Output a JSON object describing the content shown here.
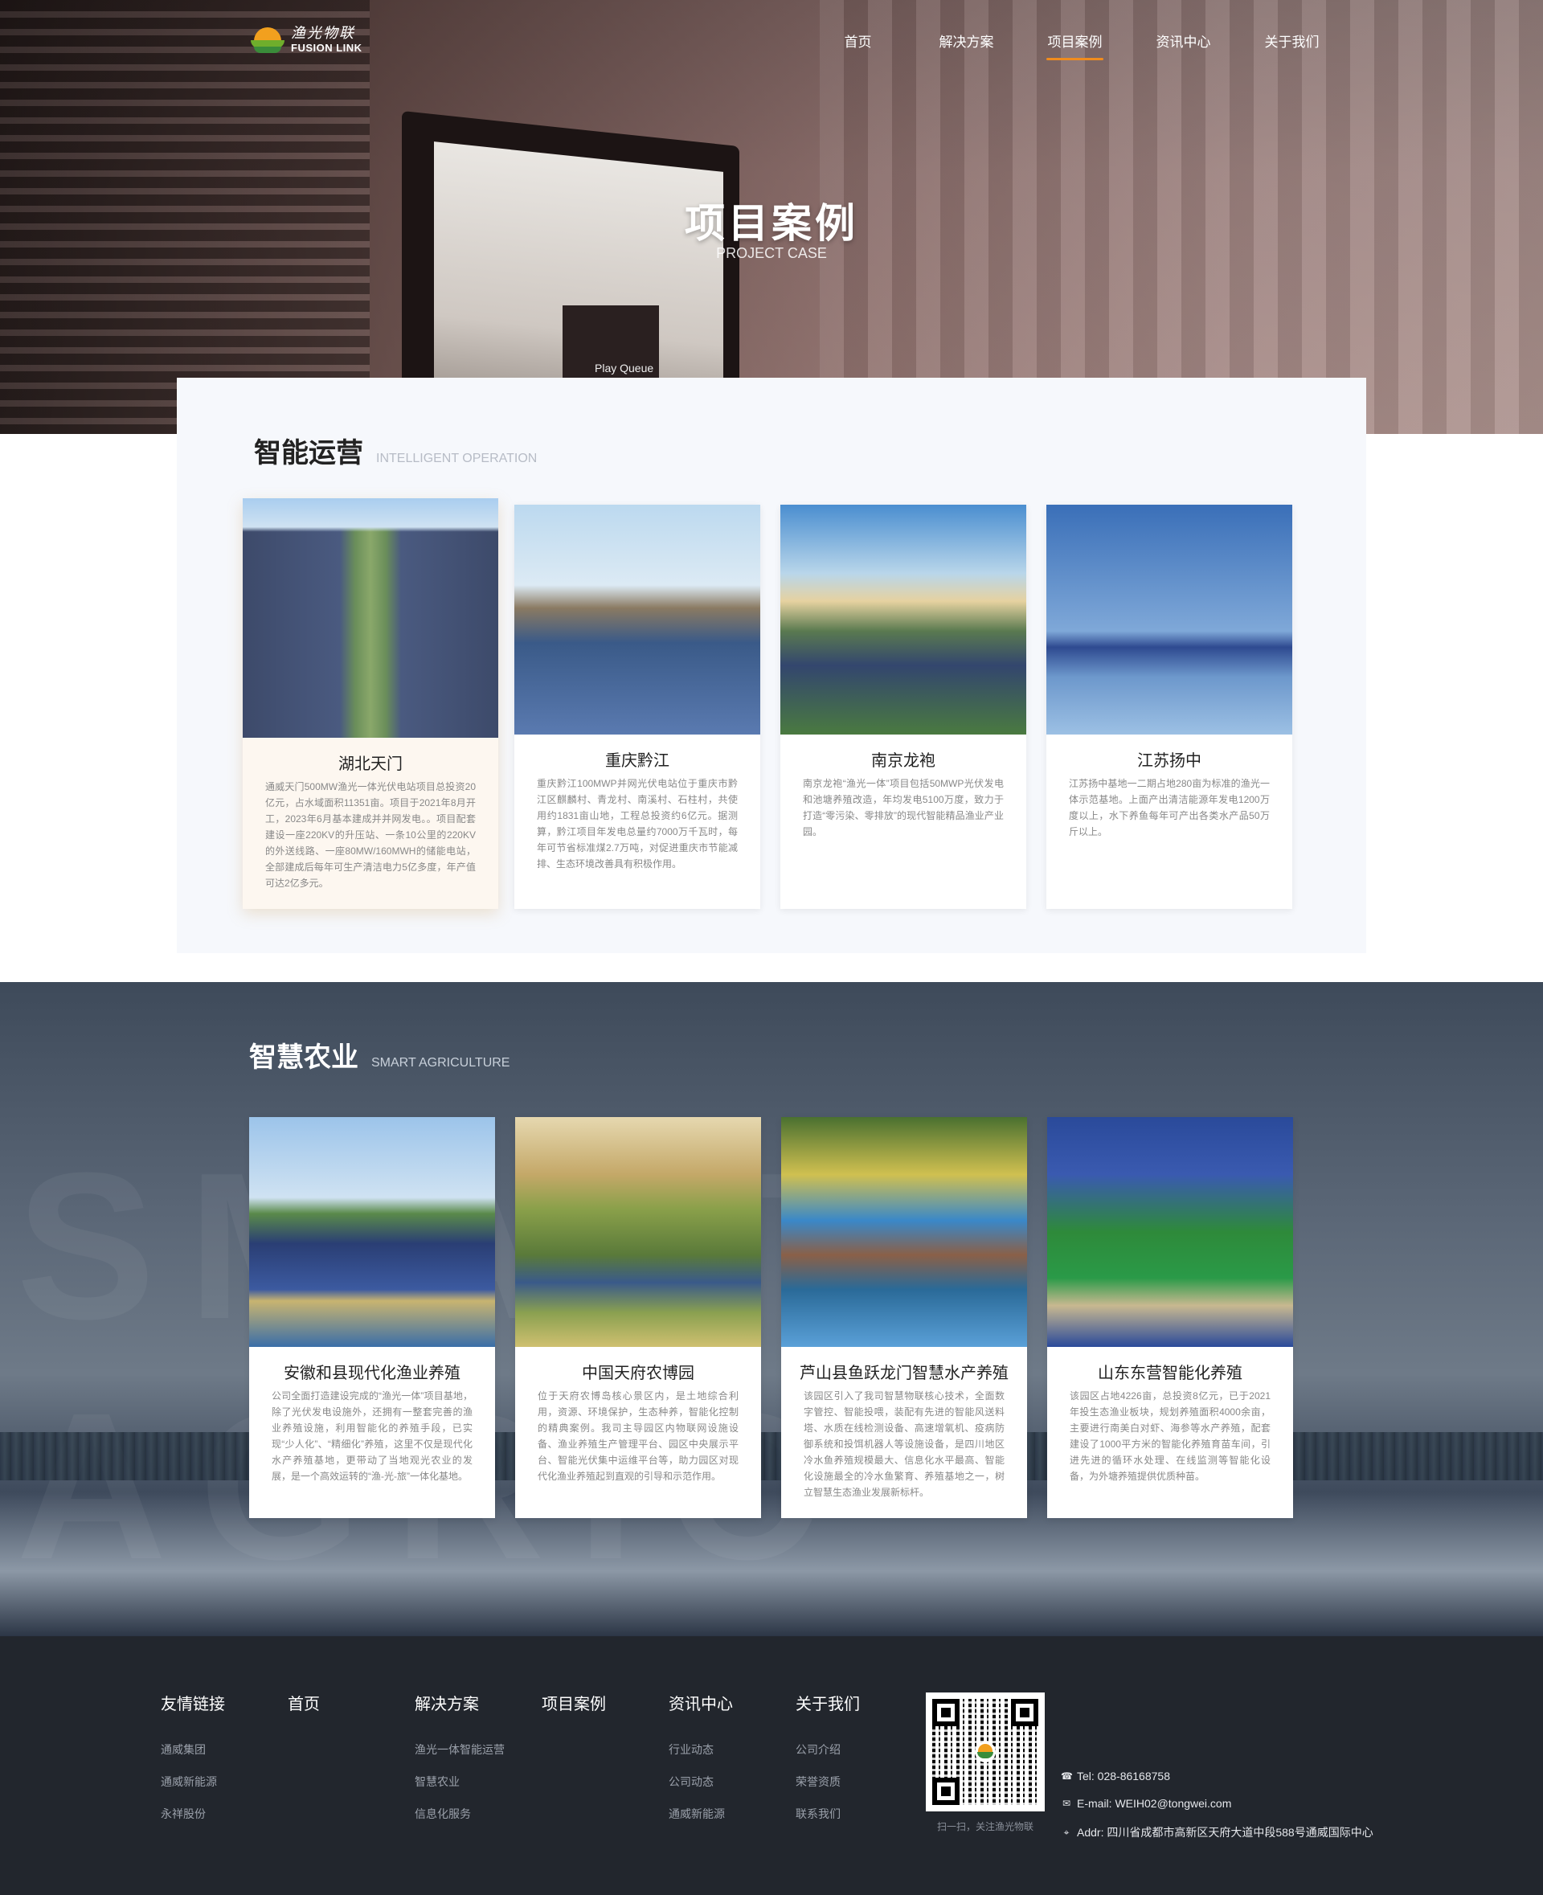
{
  "logo": {
    "cn": "渔光物联",
    "en": "FUSION LINK"
  },
  "nav": [
    {
      "label": "首页",
      "active": false
    },
    {
      "label": "解决方案",
      "active": false
    },
    {
      "label": "项目案例",
      "active": true
    },
    {
      "label": "资讯中心",
      "active": false
    },
    {
      "label": "关于我们",
      "active": false
    }
  ],
  "hero": {
    "title": "项目案例",
    "subtitle": "PROJECT CASE",
    "screen_text": "Play Queue"
  },
  "section1": {
    "title": "智能运营",
    "subtitle": "INTELLIGENT OPERATION",
    "cards": [
      {
        "name": "湖北天门",
        "desc": "通威天门500MW渔光一体光伏电站项目总投资20亿元，占水域面积11351亩。项目于2021年8月开工，2023年6月基本建成并并网发电。。项目配套建设一座220KV的升压站、一条10公里的220KV的外送线路、一座80MW/160MWH的储能电站，全部建成后每年可生产清洁电力5亿多度，年产值可达2亿多元。"
      },
      {
        "name": "重庆黔江",
        "desc": "重庆黔江100MWP并网光伏电站位于重庆市黔江区麒麟村、青龙村、南溪村、石柱村，共使用约1831亩山地，工程总投资约6亿元。据测算，黔江项目年发电总量约7000万千瓦时，每年可节省标准煤2.7万吨，对促进重庆市节能减排、生态环境改善具有积极作用。"
      },
      {
        "name": "南京龙袍",
        "desc": "南京龙袍“渔光一体”项目包括50MWP光伏发电和池塘养殖改造，年均发电5100万度，致力于打造“零污染、零排放”的现代智能精品渔业产业园。"
      },
      {
        "name": "江苏扬中",
        "desc": "江苏扬中基地一二期占地280亩为标准的渔光一体示范基地。上面产出清洁能源年发电1200万度以上，水下养鱼每年可产出各类水产品50万斤以上。"
      }
    ]
  },
  "section2": {
    "title": "智慧农业",
    "subtitle": "SMART AGRICULTURE",
    "bg_text": "SMART AGRIC",
    "cards": [
      {
        "name": "安徽和县现代化渔业养殖",
        "desc": "公司全面打造建设完成的“渔光一体”项目基地，除了光伏发电设施外，还拥有一整套完善的渔业养殖设施，利用智能化的养殖手段，已实现“少人化”、“精细化”养殖，这里不仅是现代化水产养殖基地，更带动了当地观光农业的发展，是一个高效运转的“渔-光-旅”一体化基地。"
      },
      {
        "name": "中国天府农博园",
        "desc": "位于天府农博岛核心景区内，是土地综合利用，资源、环境保护，生态种养，智能化控制的精典案例。我司主导园区内物联网设施设备、渔业养殖生产管理平台、园区中央展示平台、智能光伏集中运维平台等，助力园区对现代化渔业养殖起到直观的引导和示范作用。"
      },
      {
        "name": "芦山县鱼跃龙门智慧水产养殖",
        "desc": "该园区引入了我司智慧物联核心技术，全面数字管控、智能投喂，装配有先进的智能风送料塔、水质在线检测设备、高速增氧机、疫病防御系统和投饵机器人等设施设备，是四川地区冷水鱼养殖规模最大、信息化水平最高、智能化设施最全的冷水鱼繁育、养殖基地之一，树立智慧生态渔业发展新标杆。"
      },
      {
        "name": "山东东营智能化养殖",
        "desc": "该园区占地4226亩，总投资8亿元，已于2021年投生态渔业板块，规划养殖面积4000余亩，主要进行南美白对虾、海参等水产养殖，配套建设了1000平方米的智能化养殖育苗车间，引进先进的循环水处理、在线监测等智能化设备，为外塘养殖提供优质种苗。"
      }
    ]
  },
  "footer": {
    "columns": [
      {
        "head": "友情链接",
        "links": [
          "通威集团",
          "通威新能源",
          "永祥股份"
        ]
      },
      {
        "head": "首页",
        "links": []
      },
      {
        "head": "解决方案",
        "links": [
          "渔光一体智能运营",
          "智慧农业",
          "信息化服务"
        ]
      },
      {
        "head": "项目案例",
        "links": []
      },
      {
        "head": "资讯中心",
        "links": [
          "行业动态",
          "公司动态",
          "通威新能源"
        ]
      },
      {
        "head": "关于我们",
        "links": [
          "公司介绍",
          "荣誉资质",
          "联系我们"
        ]
      }
    ],
    "qr_caption": "扫一扫，关注渔光物联",
    "contact": {
      "tel": "Tel:  028-86168758",
      "email": "E-mail:  WEIH02@tongwei.com",
      "addr": "Addr:  四川省成都市高新区天府大道中段588号通威国际中心"
    }
  },
  "colors": {
    "accent": "#f08c1e",
    "footer_bg": "#22262d",
    "section_bg": "#f6f8fc"
  },
  "icons": [
    "phone-icon",
    "mail-icon",
    "location-icon"
  ]
}
